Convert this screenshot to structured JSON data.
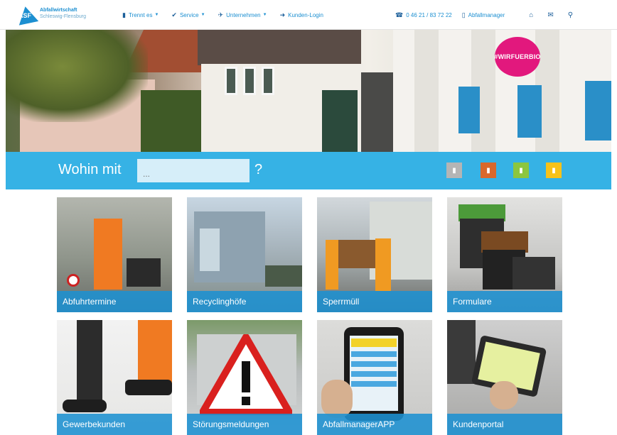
{
  "nav": {
    "logo": {
      "mark_letters": "ASF",
      "line1": "Abfallwirtschaft",
      "line2": "Schleswig-Flensburg"
    },
    "items": [
      {
        "label": "Trennt es",
        "icon": "trash-icon",
        "dropdown": true
      },
      {
        "label": "Service",
        "icon": "check-icon",
        "dropdown": true
      },
      {
        "label": "Unternehmen",
        "icon": "plane-icon",
        "dropdown": true
      },
      {
        "label": "Kunden-Login",
        "icon": "login-icon",
        "dropdown": false
      }
    ],
    "right_items": [
      {
        "label": "0 46 21 / 83 72 22",
        "icon": "phone-icon"
      },
      {
        "label": "Abfallmanager",
        "icon": "phone-app-icon"
      }
    ],
    "icon_buttons": [
      "home-icon",
      "envelope-icon",
      "search-icon"
    ]
  },
  "hero": {
    "badge_text": "#WIRFUERBIO"
  },
  "search": {
    "label": "Wohin mit",
    "placeholder": "...",
    "suffix": "?",
    "bin_buttons": [
      {
        "name": "restmuell",
        "color": "#b5b5b5"
      },
      {
        "name": "biotonne",
        "color": "#d9682c"
      },
      {
        "name": "gelber-sack",
        "color": "#8cc63f"
      },
      {
        "name": "papiertonne",
        "color": "#f7c21a"
      }
    ]
  },
  "tiles": [
    {
      "label": "Abfuhrtermine"
    },
    {
      "label": "Recyclinghöfe"
    },
    {
      "label": "Sperrmüll"
    },
    {
      "label": "Formulare"
    },
    {
      "label": "Gewerbekunden"
    },
    {
      "label": "Störungsmeldungen"
    },
    {
      "label": "AbfallmanagerAPP"
    },
    {
      "label": "Kundenportal"
    }
  ]
}
